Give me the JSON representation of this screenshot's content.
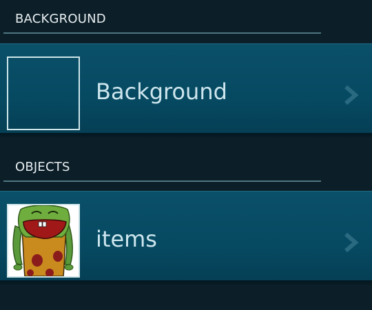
{
  "sections": [
    {
      "header": "BACKGROUND",
      "row": {
        "label": "Background",
        "thumbnail": "empty-frame"
      }
    },
    {
      "header": "OBJECTS",
      "row": {
        "label": "items",
        "thumbnail": "green-monster-icon"
      }
    }
  ],
  "colors": {
    "app_background": "#0c1f28",
    "row_background": "#064a62",
    "header_text": "#e8eef1",
    "row_text": "#cde6ee",
    "divider": "#4f7783",
    "chevron": "#2a6a80"
  }
}
